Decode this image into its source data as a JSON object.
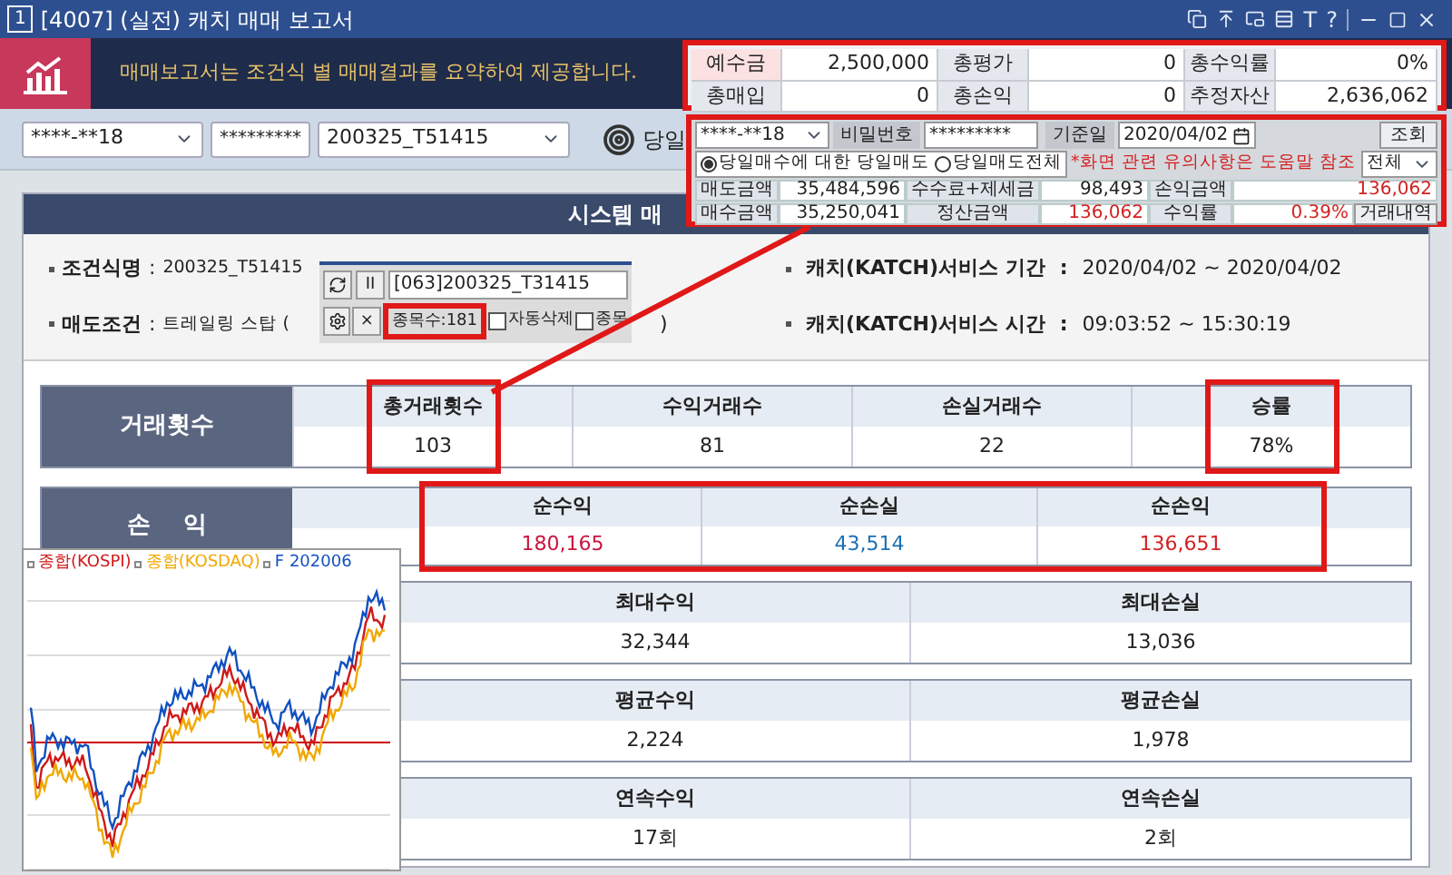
{
  "window": {
    "badge": "1",
    "title": "[4007] (실전) 캐치 매매 보고서",
    "tool_glyphs": [
      "T",
      "?"
    ]
  },
  "banner": {
    "text": "매매보고서는 조건식 별 매매결과를 요약하여 제공합니다."
  },
  "toolbar": {
    "account": "****-**18",
    "password": "*********",
    "condition": "200325_T51415",
    "today_label": "당일"
  },
  "summary": [
    [
      {
        "label": "예수금",
        "highlight": true,
        "value": "2,500,000"
      },
      {
        "label": "총평가",
        "highlight": false,
        "value": "0"
      },
      {
        "label": "총수익률",
        "highlight": false,
        "value": "0%"
      }
    ],
    [
      {
        "label": "총매입",
        "highlight": false,
        "value": "0"
      },
      {
        "label": "총손익",
        "highlight": false,
        "value": "0"
      },
      {
        "label": "추정자산",
        "highlight": false,
        "value": "2,636,062"
      }
    ]
  ],
  "account_panel": {
    "account": "****-**18",
    "password_label": "비밀번호",
    "password": "*********",
    "date_label": "기준일",
    "date": "2020/04/02",
    "query_button": "조회",
    "radios": [
      {
        "label": "당일매수에 대한 당일매도",
        "selected": true
      },
      {
        "label": "당일매도전체",
        "selected": false
      }
    ],
    "notice": "*화면 관련 유의사항은 도움말 참조",
    "filter": "전체",
    "rows": [
      [
        {
          "label": "매도금액",
          "value": "35,484,596"
        },
        {
          "label": "수수료+제세금",
          "value": "98,493"
        },
        {
          "label": "손익금액",
          "value": "136,062",
          "color": "#d42020"
        }
      ],
      [
        {
          "label": "매수금액",
          "value": "35,250,041"
        },
        {
          "label": "정산금액",
          "value": "136,062",
          "color": "#d42020"
        },
        {
          "label": "수익률",
          "value": "0.39%",
          "color": "#d42020"
        }
      ]
    ],
    "history_button": "거래내역"
  },
  "report": {
    "header": "시스템 매",
    "left_info": [
      {
        "label": "조건식명",
        "separator": ":",
        "value": "200325_T51415"
      },
      {
        "label": "매도조건",
        "separator": ":",
        "value": "트레일링 스탑 ("
      }
    ],
    "sell_condition_tail": ")",
    "right_info": [
      {
        "label": "캐치(KATCH)서비스 기간",
        "separator": ":",
        "value": "2020/04/02 ~ 2020/04/02"
      },
      {
        "label": "캐치(KATCH)서비스 시간",
        "separator": ":",
        "value": "09:03:52 ~ 15:30:19"
      }
    ],
    "trades": {
      "label": "거래횟수",
      "columns": [
        {
          "header": "총거래횟수",
          "value": "103",
          "highlighted": true
        },
        {
          "header": "수익거래수",
          "value": "81",
          "highlighted": false
        },
        {
          "header": "손실거래수",
          "value": "22",
          "highlighted": false
        },
        {
          "header": "승률",
          "value": "78%",
          "highlighted": true
        }
      ]
    },
    "pnl": {
      "label": "손    익",
      "highlighted": true,
      "columns": [
        {
          "header": "순수익",
          "value": "180,165",
          "color": "#c8143c"
        },
        {
          "header": "순손실",
          "value": "43,514",
          "color": "#1a6fb5"
        },
        {
          "header": "순손익",
          "value": "136,651",
          "color": "#d42020"
        }
      ]
    },
    "stats": [
      [
        {
          "header": "최대수익",
          "value": "32,344"
        },
        {
          "header": "최대손실",
          "value": "13,036"
        }
      ],
      [
        {
          "header": "평균수익",
          "value": "2,224"
        },
        {
          "header": "평균손실",
          "value": "1,978"
        }
      ],
      [
        {
          "header": "연속수익",
          "value": "17회"
        },
        {
          "header": "연속손실",
          "value": "2회"
        }
      ]
    ]
  },
  "mini_window": {
    "pause": "II",
    "title": "[063]200325_T31415",
    "close": "×",
    "count": "종목수:181",
    "count_highlighted": true,
    "checkboxes": [
      {
        "label": "자동삭제",
        "checked": false
      },
      {
        "label": "종목",
        "checked": false
      }
    ]
  },
  "chart": {
    "legend": [
      {
        "name": "종합(KOSPI)",
        "color": "#d01818"
      },
      {
        "name": "종합(KOSDAQ)",
        "color": "#f0a800"
      },
      {
        "name": "F 202006",
        "color": "#1050c0"
      }
    ]
  }
}
